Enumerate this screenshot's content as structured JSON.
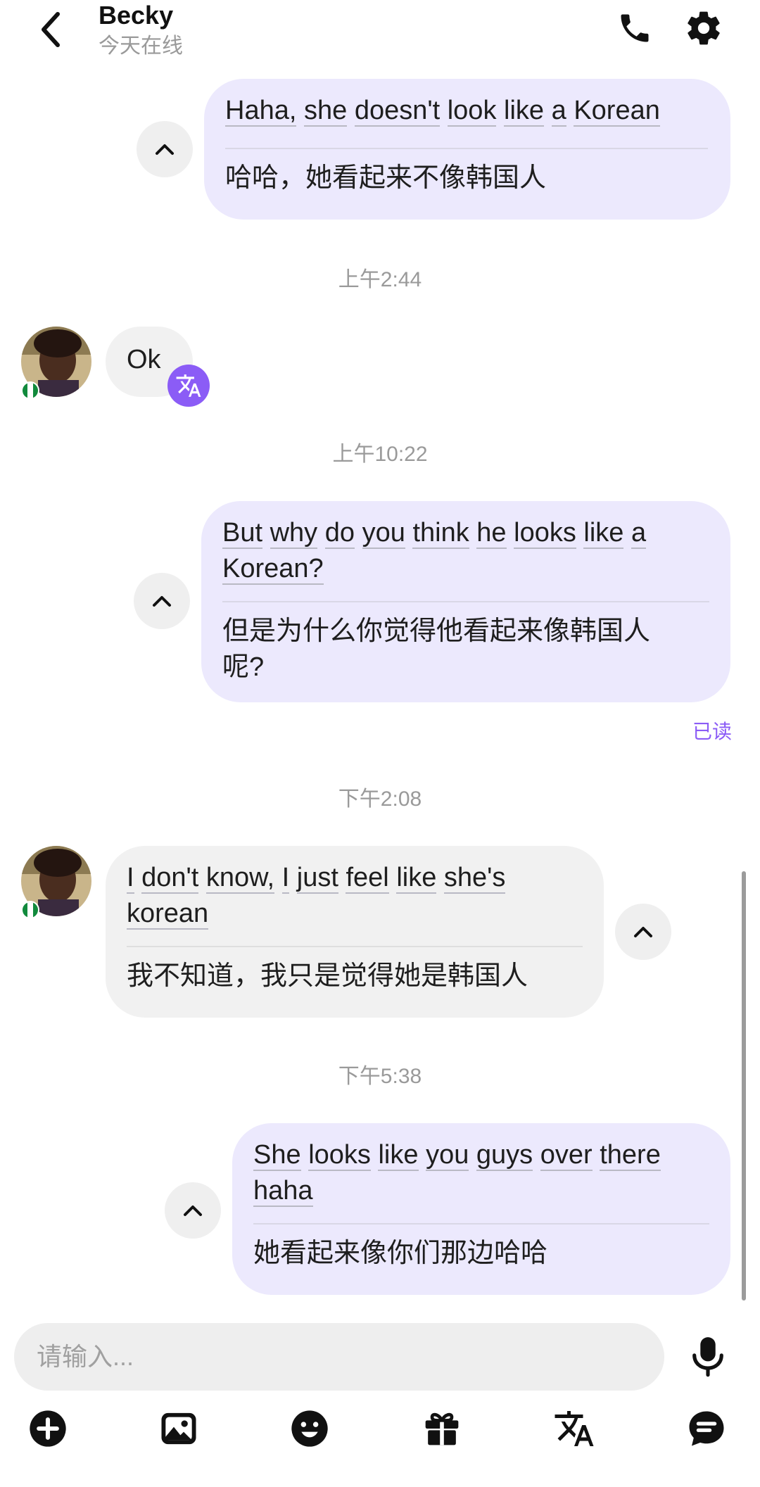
{
  "header": {
    "name": "Becky",
    "status": "今天在线",
    "icons": {
      "back": "chevron-left-icon",
      "call": "phone-icon",
      "settings": "gear-icon"
    }
  },
  "messages": {
    "m1": {
      "direction": "outgoing",
      "words": [
        "Haha,",
        "she",
        "doesn't",
        "look",
        "like",
        "a",
        "Korean"
      ],
      "translation": "哈哈，她看起来不像韩国人"
    },
    "t1": "上午2:44",
    "m2": {
      "direction": "incoming",
      "text": "Ok"
    },
    "t2": "上午10:22",
    "m3": {
      "direction": "outgoing",
      "words_line1": [
        "But",
        "why",
        "do",
        "you",
        "think",
        "he",
        "looks",
        "like",
        "a"
      ],
      "words_line2": [
        "Korean?"
      ],
      "translation_line1": "但是为什么你觉得他看起来像韩国人",
      "translation_line2": "呢?"
    },
    "read_receipt": "已读",
    "t3": "下午2:08",
    "m4": {
      "direction": "incoming",
      "words_line1": [
        "I",
        "don't",
        "know,",
        "I",
        "just",
        "feel",
        "like",
        "she's"
      ],
      "words_line2": [
        "korean"
      ],
      "translation": "我不知道，我只是觉得她是韩国人"
    },
    "t4": "下午5:38",
    "m5": {
      "direction": "outgoing",
      "words_line1": [
        "She",
        "looks",
        "like",
        "you",
        "guys",
        "over",
        "there"
      ],
      "words_line2": [
        "haha"
      ],
      "translation": "她看起来像你们那边哈哈"
    }
  },
  "composer": {
    "placeholder": "请输入..."
  },
  "toolbar": [
    "plus-icon",
    "image-icon",
    "emoji-icon",
    "gift-icon",
    "translate-icon",
    "chat-icon"
  ],
  "colors": {
    "accent": "#8b5cf6",
    "outgoing_bubble": "#ece9fd",
    "incoming_bubble": "#f1f1f1"
  }
}
